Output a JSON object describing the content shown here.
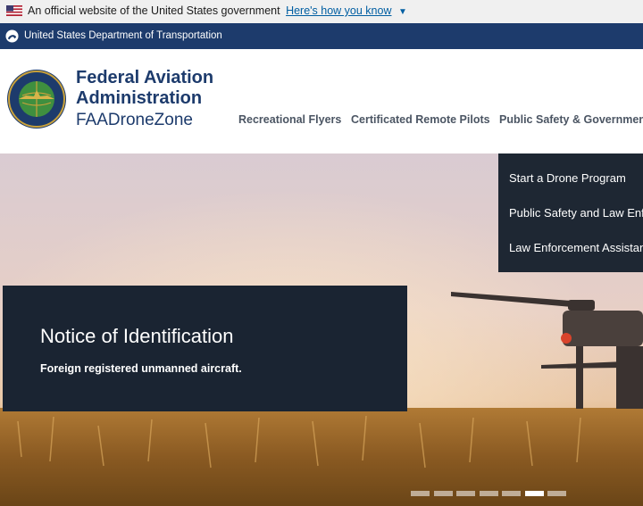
{
  "gov_banner": {
    "text": "An official website of the United States government",
    "link": "Here's how you know"
  },
  "dot_bar": {
    "text": "United States Department of Transportation"
  },
  "brand": {
    "line1": "Federal Aviation",
    "line2": "Administration",
    "line3": "FAADroneZone"
  },
  "nav": {
    "items": [
      {
        "label": "Recreational Flyers"
      },
      {
        "label": "Certificated Remote Pilots"
      },
      {
        "label": "Public Safety & Government"
      }
    ]
  },
  "dropdown": {
    "items": [
      {
        "label": "Start a Drone Program"
      },
      {
        "label": "Public Safety and Law Enforcement"
      },
      {
        "label": "Law Enforcement Assistance"
      }
    ]
  },
  "hero": {
    "title": "Notice of Identification",
    "subtitle": "Foreign registered unmanned aircraft.",
    "slide_count": 7,
    "active_slide": 6
  },
  "colors": {
    "navy": "#1d3b6c",
    "link": "#005ea2",
    "panel": "#1a2432"
  }
}
